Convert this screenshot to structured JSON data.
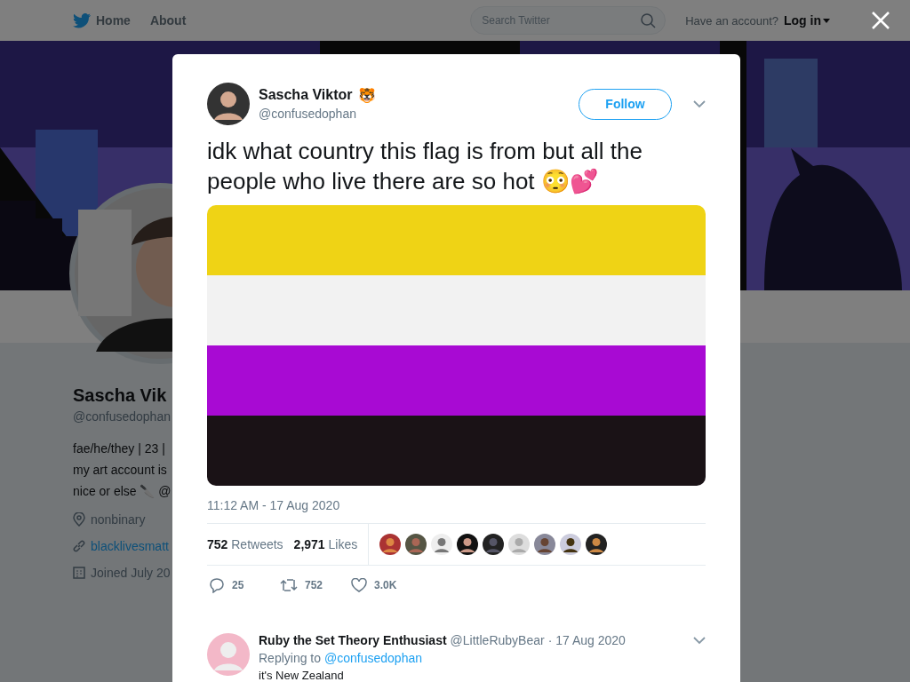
{
  "nav": {
    "items": [
      {
        "label": "Home",
        "kind": "home"
      },
      {
        "label": "About",
        "kind": "plain"
      }
    ],
    "search_placeholder": "Search Twitter",
    "account_prompt": "Have an account?",
    "login": "Log in"
  },
  "profile": {
    "name": "Sascha Vik",
    "handle": "@confusedophan",
    "bio": [
      "fae/he/they | 23 |",
      "my art account is",
      "nice or else 🔪 @"
    ],
    "location": "nonbinary",
    "link": "blacklivesmatt",
    "joined": "Joined July 20"
  },
  "tweet": {
    "name": "Sascha Viktor",
    "name_emoji": "🐯",
    "handle": "@confusedophan",
    "follow": "Follow",
    "text": "idk what country this flag is from but all the people who live there are so hot 😳💕",
    "timestamp": "11:12 AM - 17 Aug 2020",
    "retweets": {
      "count": "752",
      "label": "Retweets"
    },
    "likes": {
      "count": "2,971",
      "label": "Likes"
    },
    "actions": [
      {
        "kind": "reply",
        "count": "25"
      },
      {
        "kind": "retweet",
        "count": "752"
      },
      {
        "kind": "like",
        "count": "3.0K"
      }
    ]
  },
  "reply": {
    "name": "Ruby the Set Theory Enthusiast",
    "handle": "@LittleRubyBear",
    "date": "· 17 Aug 2020",
    "replying_prefix": "Replying to",
    "replying_handle": "@confusedophan",
    "text": "it's New Zealand"
  }
}
